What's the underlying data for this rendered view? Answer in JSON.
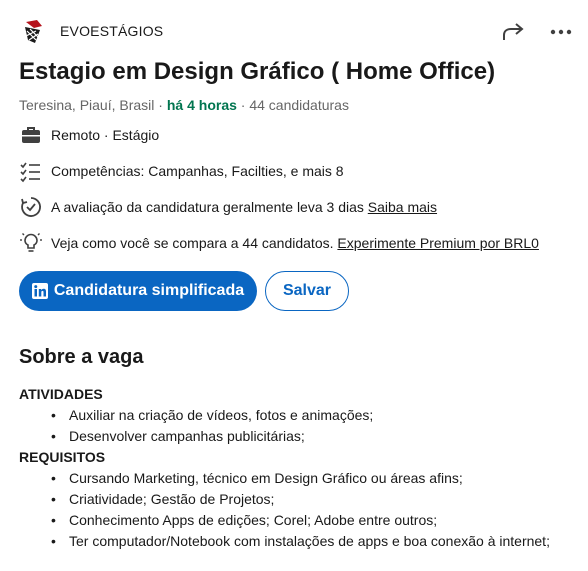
{
  "company": {
    "name": "EVOESTÁGIOS"
  },
  "job": {
    "title": "Estagio em Design Gráfico ( Home Office)",
    "location": "Teresina, Piauí, Brasil",
    "sep1": " · ",
    "posted": "há 4 horas",
    "sep2": " · ",
    "applicants": "44 candidaturas"
  },
  "insights": {
    "workplace": "Remoto · Estágio",
    "skills": "Competências: Campanhas, Facilties, e mais 8",
    "review_text": "A avaliação da candidatura geralmente leva 3 dias ",
    "review_link": "Saiba mais",
    "compare_text": "Veja como você se compara a 44 candidatos. ",
    "compare_link": "Experimente Premium por BRL0"
  },
  "actions": {
    "apply_label": "Candidatura simplificada",
    "save_label": "Salvar"
  },
  "about": {
    "title": "Sobre a vaga",
    "activities_heading": "ATIVIDADES",
    "activities": [
      "Auxiliar na criação de vídeos, fotos e animações;",
      "Desenvolver campanhas publicitárias;"
    ],
    "requirements_heading": "REQUISITOS",
    "requirements": [
      "Cursando Marketing, técnico em Design Gráfico ou áreas afins;",
      "Criatividade; Gestão de Projetos;",
      "Conhecimento Apps de edições; Corel; Adobe entre outros;",
      "Ter computador/Notebook com instalações de apps e boa conexão à internet;"
    ]
  },
  "icons": {
    "logo": "company-logo",
    "share": "share-arrow-icon",
    "more": "more-dots-icon",
    "workplace": "briefcase-icon",
    "skills": "checklist-icon",
    "review": "clock-check-icon",
    "compare": "lightbulb-icon",
    "apply": "linkedin-icon"
  },
  "colors": {
    "brand": "#0a66c2",
    "posted": "#01754f",
    "muted": "#666666"
  }
}
